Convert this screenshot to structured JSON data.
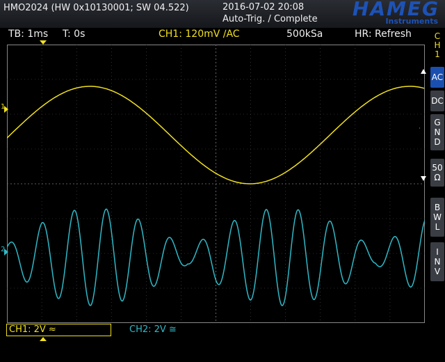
{
  "header": {
    "model": "HMO2024 (HW 0x10130001; SW 04.522)",
    "datetime": "2016-07-02 20:08",
    "trigger_status": "Auto-Trig. / Complete",
    "brand": "HAMEG",
    "brand_sub": "Instruments"
  },
  "status": {
    "timebase": "TB: 1ms",
    "trigger_time": "T: 0s",
    "ch1_setting": "CH1: 120mV ∕AC",
    "sample_rate": "500kSa",
    "hr": "HR: Refresh"
  },
  "sidebar": {
    "channel": [
      "C",
      "H",
      "1"
    ],
    "buttons": [
      {
        "label": "AC",
        "active": true
      },
      {
        "label": "DC",
        "active": false
      },
      {
        "label": "G N D",
        "active": false
      },
      {
        "label": "50 Ω",
        "active": false
      },
      {
        "label": "B W L",
        "active": false
      },
      {
        "label": "I N V",
        "active": false
      }
    ]
  },
  "bottom": {
    "ch1_scale": "CH1: 2V ≈",
    "ch2_scale": "CH2: 2V ≅"
  },
  "markers": {
    "ch1_marker": "1",
    "ch2_marker": "2"
  },
  "colors": {
    "ch1": "#f0e020",
    "ch2": "#2fb9c7",
    "grid": "#555555",
    "brand": "#1d52b6",
    "active_button": "#1a4fb0"
  }
}
